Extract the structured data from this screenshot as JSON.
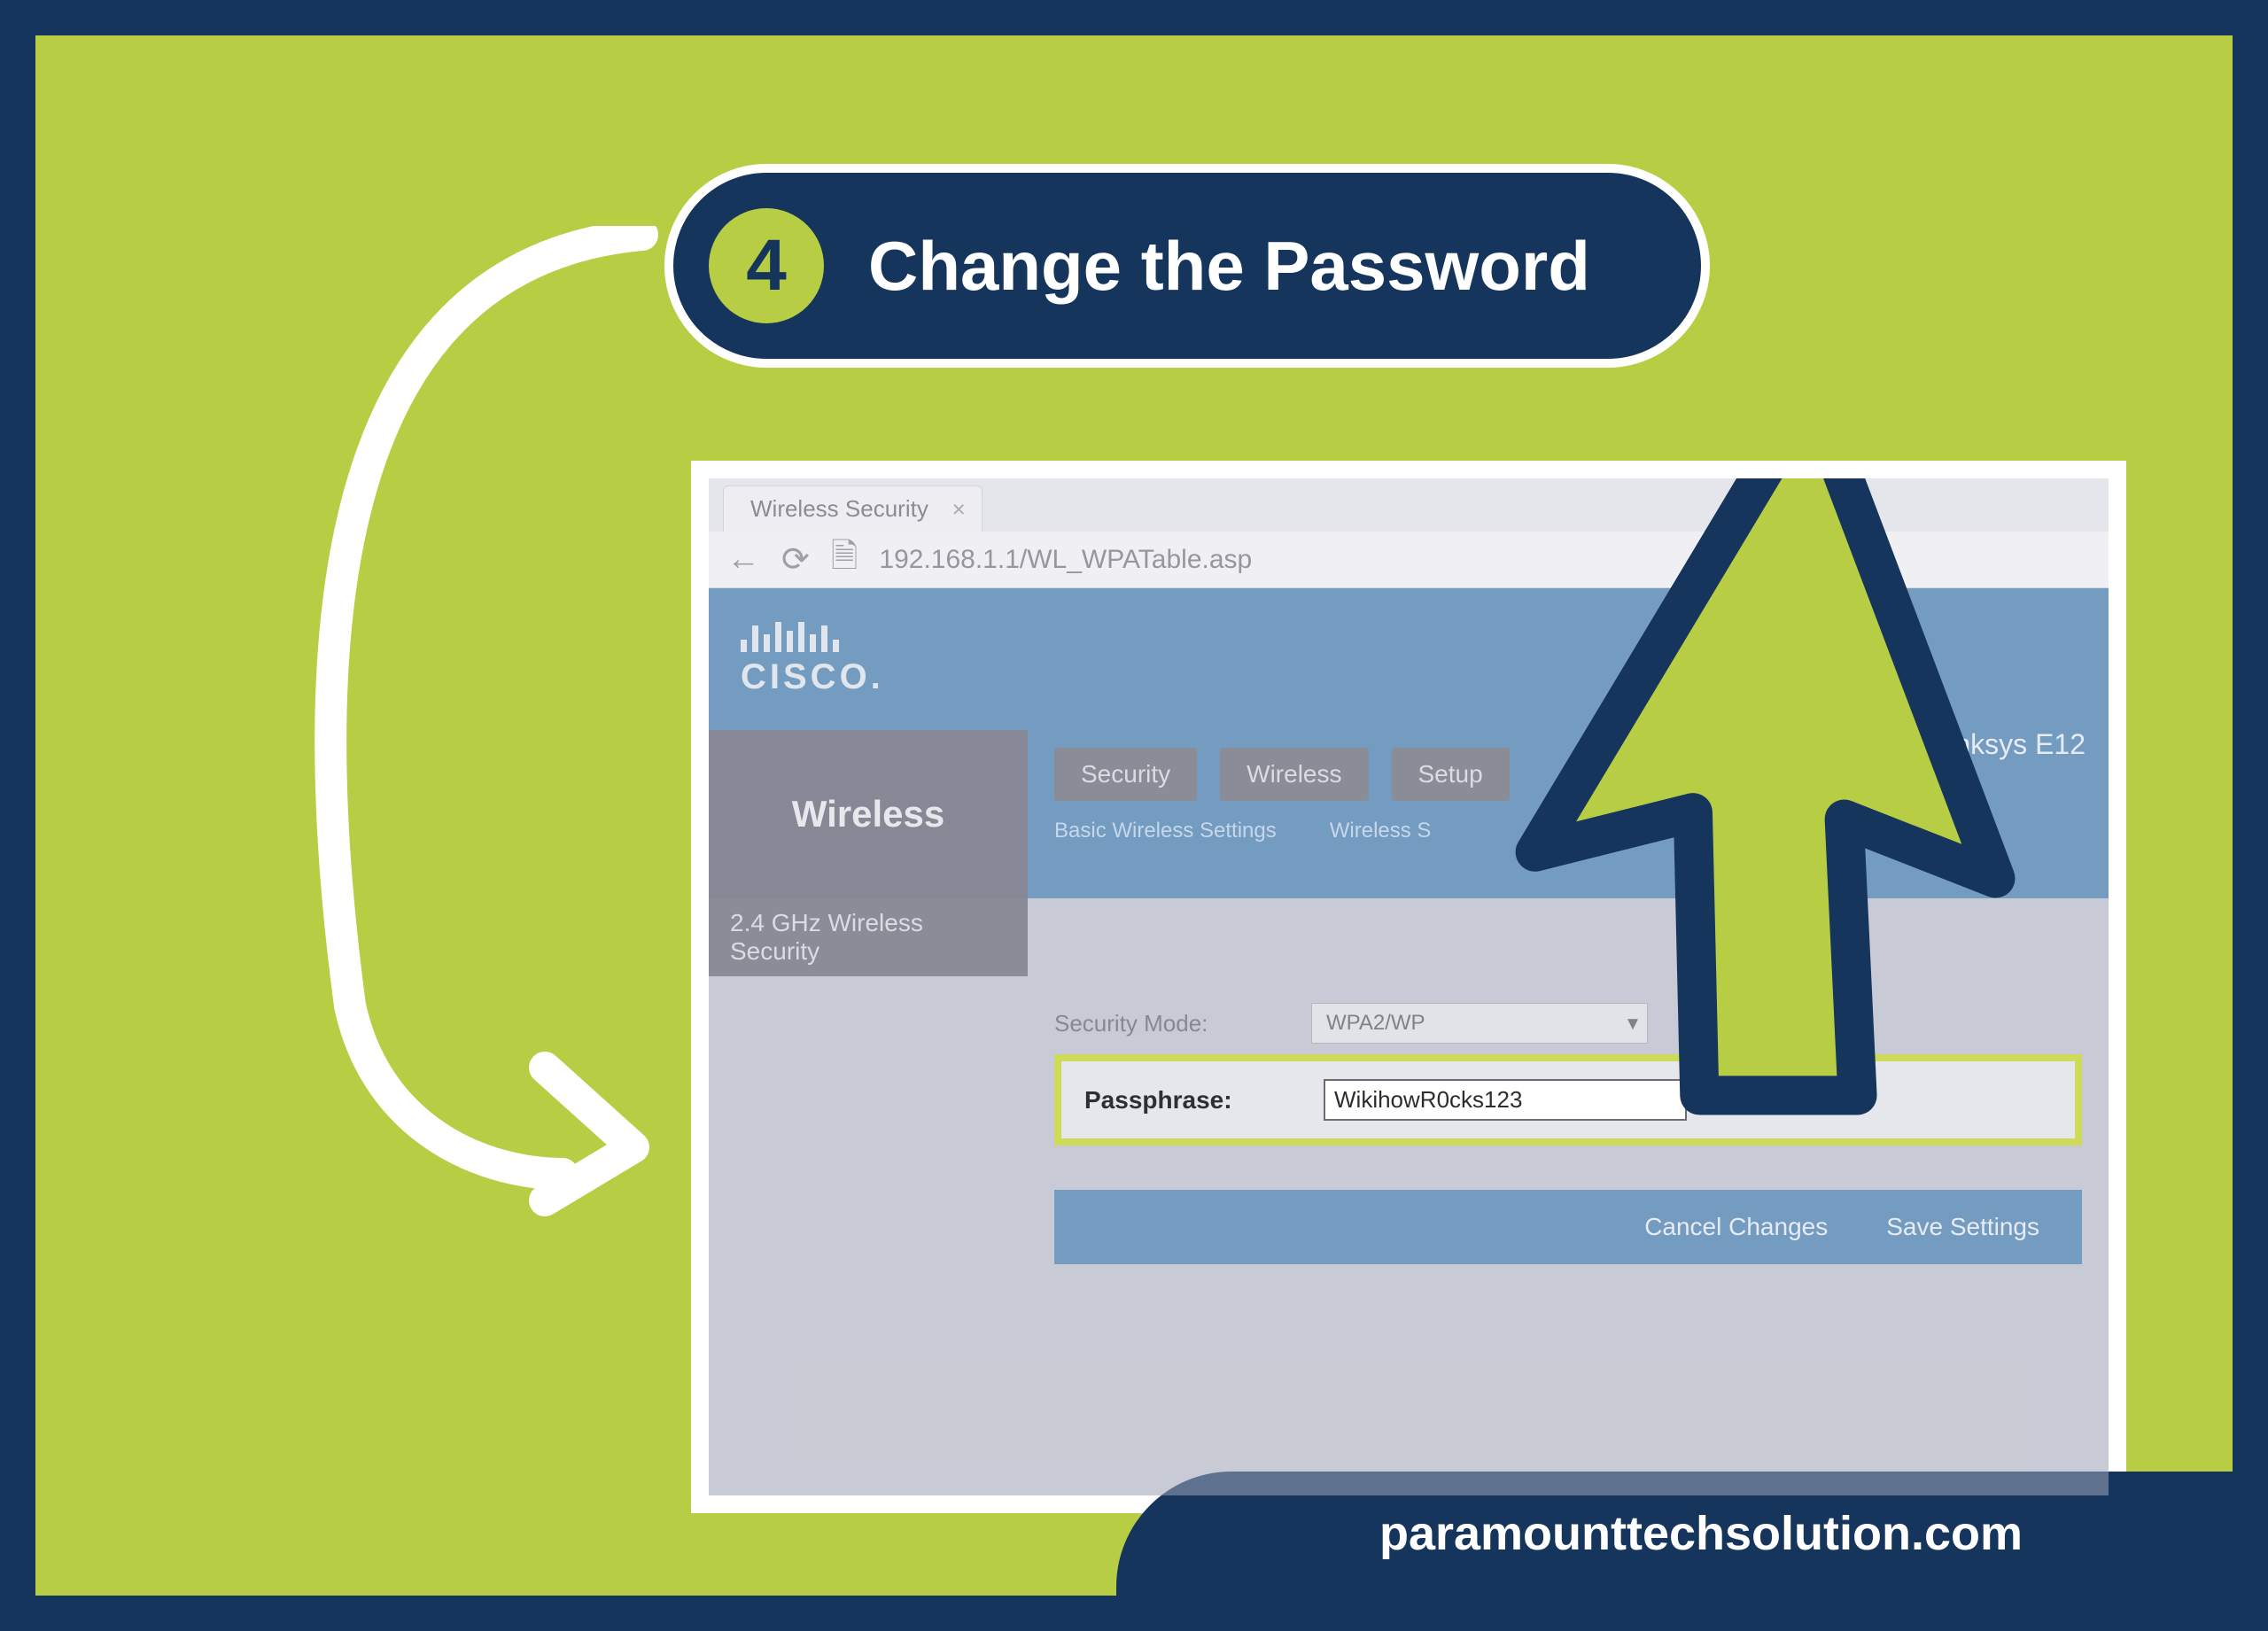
{
  "step": {
    "number": "4",
    "title": "Change the Password"
  },
  "browser": {
    "tab_title": "Wireless Security",
    "url": "192.168.1.1/WL_WPATable.asp"
  },
  "router": {
    "brand_text": "CISCO.",
    "model": "Linksys E12",
    "nav_left": "Wireless",
    "tabs": [
      "Security",
      "Wireless",
      "Setup"
    ],
    "subnav": [
      "Basic Wireless Settings",
      "Wireless S"
    ],
    "section_title": "2.4 GHz Wireless Security",
    "security_mode_label": "Security Mode:",
    "security_mode_value": "WPA2/WP",
    "passphrase_label": "Passphrase:",
    "passphrase_value": "WikihowR0cks123",
    "cancel_label": "Cancel Changes",
    "save_label": "Save Settings"
  },
  "footer_site": "paramounttechsolution.com"
}
